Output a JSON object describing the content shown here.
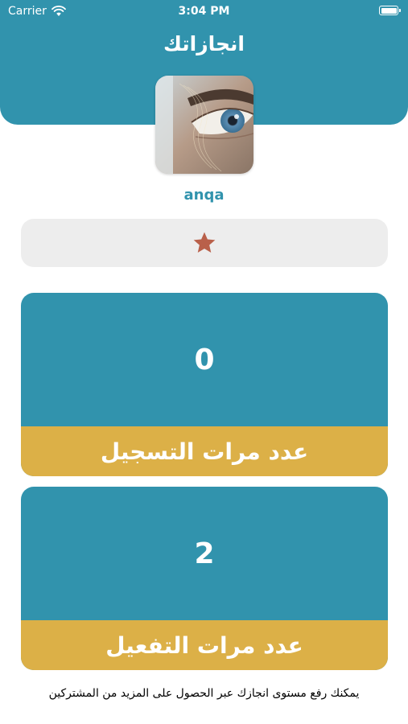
{
  "status_bar": {
    "carrier": "Carrier",
    "time": "3:04 PM"
  },
  "header": {
    "title": "انجازاتك"
  },
  "profile": {
    "username": "anqa",
    "avatar_alt": "eye-photo"
  },
  "rating": {
    "stars": 1,
    "icon": "star-icon",
    "color": "#b9604a"
  },
  "stats": [
    {
      "value": "0",
      "label": "عدد مرات التسجيل"
    },
    {
      "value": "2",
      "label": "عدد مرات التفعيل"
    }
  ],
  "footer": {
    "note": "يمكنك رفع مستوى انجازك عبر الحصول على المزيد من المشتركين"
  },
  "colors": {
    "primary": "#3193ad",
    "accent": "#dcb047",
    "muted": "#ededed"
  }
}
